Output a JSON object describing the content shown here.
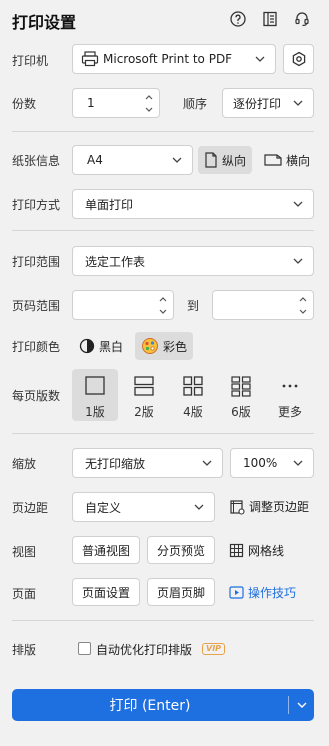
{
  "header": {
    "title": "打印设置",
    "icons": [
      "help-icon",
      "layout-icon",
      "headset-icon"
    ]
  },
  "printer": {
    "label": "打印机",
    "value": "Microsoft Print to PDF"
  },
  "copies": {
    "label": "份数",
    "value": "1"
  },
  "order": {
    "label": "顺序",
    "value": "逐份打印"
  },
  "paper": {
    "label": "纸张信息",
    "value": "A4",
    "portrait": "纵向",
    "landscape": "横向"
  },
  "print_mode": {
    "label": "打印方式",
    "value": "单面打印"
  },
  "range": {
    "label": "打印范围",
    "value": "选定工作表"
  },
  "pages": {
    "label": "页码范围",
    "to": "到"
  },
  "color": {
    "label": "打印颜色",
    "bw": "黑白",
    "color": "彩色"
  },
  "per_page": {
    "label": "每页版数",
    "options": [
      "1版",
      "2版",
      "4版",
      "6版",
      "更多"
    ]
  },
  "scale": {
    "label": "缩放",
    "value": "无打印缩放",
    "percent": "100%"
  },
  "margin": {
    "label": "页边距",
    "value": "自定义",
    "adjust": "调整页边距"
  },
  "view": {
    "label": "视图",
    "normal": "普通视图",
    "page_break": "分页预览",
    "gridlines": "网格线"
  },
  "page": {
    "label": "页面",
    "setup": "页面设置",
    "header_footer": "页眉页脚",
    "tips": "操作技巧"
  },
  "layout": {
    "label": "排版",
    "auto": "自动优化打印排版",
    "vip": "VIP"
  },
  "print_button": {
    "label": "打印 (Enter)"
  },
  "colors": {
    "accent": "#1e6fe0",
    "selected": "#dcdcdc",
    "vip": "#e8a24a"
  }
}
